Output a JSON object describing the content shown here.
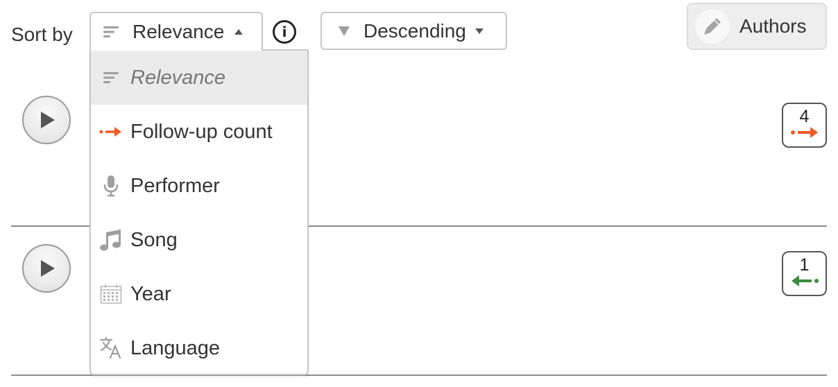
{
  "sort": {
    "label": "Sort by",
    "selected": "Relevance",
    "info_symbol": "i"
  },
  "direction": {
    "selected": "Descending"
  },
  "authors_button": {
    "label": "Authors"
  },
  "dropdown": {
    "options": [
      {
        "label": "Relevance",
        "icon": "sort-lines-icon",
        "selected": true
      },
      {
        "label": "Follow-up count",
        "icon": "follow-up-arrow-icon",
        "selected": false
      },
      {
        "label": "Performer",
        "icon": "microphone-icon",
        "selected": false
      },
      {
        "label": "Song",
        "icon": "music-note-icon",
        "selected": false
      },
      {
        "label": "Year",
        "icon": "calendar-icon",
        "selected": false
      },
      {
        "label": "Language",
        "icon": "translate-icon",
        "selected": false
      }
    ]
  },
  "results": [
    {
      "count": "4",
      "direction": "follow-up",
      "arrow_color": "#ef5b25"
    },
    {
      "count": "1",
      "direction": "reply",
      "arrow_color": "#3d8b40"
    }
  ],
  "colors": {
    "accent_orange": "#ef5b25",
    "accent_green": "#3d8b40",
    "border": "#c6c6c6",
    "icon_gray": "#9e9e9e"
  }
}
